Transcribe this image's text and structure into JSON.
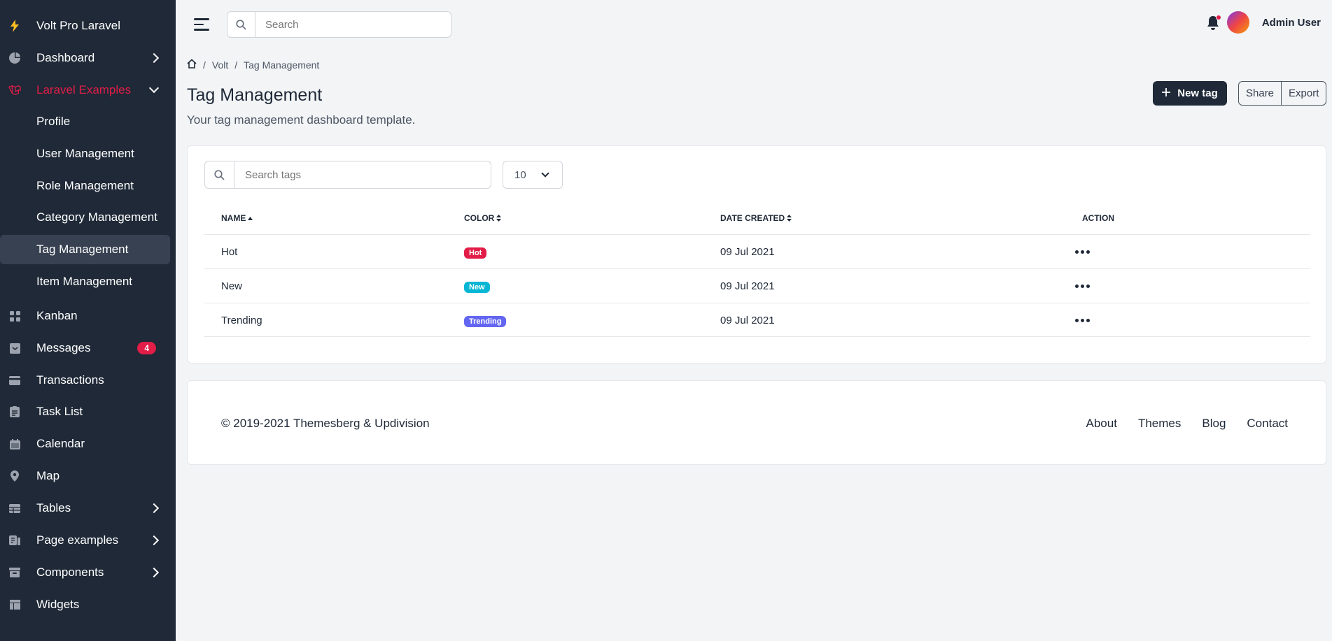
{
  "sidebar": {
    "brand": "Volt Pro Laravel",
    "items": [
      {
        "label": "Dashboard",
        "icon": "pie-chart-icon"
      },
      {
        "label": "Laravel Examples",
        "icon": "laravel-icon"
      },
      {
        "label": "Profile"
      },
      {
        "label": "User Management"
      },
      {
        "label": "Role Management"
      },
      {
        "label": "Category Management"
      },
      {
        "label": "Tag Management"
      },
      {
        "label": "Item Management"
      },
      {
        "label": "Kanban",
        "icon": "grid-icon"
      },
      {
        "label": "Messages",
        "icon": "inbox-icon",
        "badge": "4"
      },
      {
        "label": "Transactions",
        "icon": "credit-card-icon"
      },
      {
        "label": "Task List",
        "icon": "clipboard-icon"
      },
      {
        "label": "Calendar",
        "icon": "calendar-icon"
      },
      {
        "label": "Map",
        "icon": "location-icon"
      },
      {
        "label": "Tables",
        "icon": "table-icon"
      },
      {
        "label": "Page examples",
        "icon": "pages-icon"
      },
      {
        "label": "Components",
        "icon": "archive-icon"
      },
      {
        "label": "Widgets",
        "icon": "widgets-icon"
      }
    ]
  },
  "topbar": {
    "search_placeholder": "Search",
    "user_name": "Admin User"
  },
  "breadcrumb": [
    "Volt",
    "Tag Management"
  ],
  "page": {
    "title": "Tag Management",
    "subtitle": "Your tag management dashboard template.",
    "new_button": "New tag",
    "share_button": "Share",
    "export_button": "Export"
  },
  "table": {
    "search_placeholder": "Search tags",
    "per_page": "10",
    "headers": [
      "NAME",
      "COLOR",
      "DATE CREATED",
      "ACTION"
    ],
    "rows": [
      {
        "name": "Hot",
        "color_label": "Hot",
        "color": "#e11d48",
        "date": "09 Jul 2021"
      },
      {
        "name": "New",
        "color_label": "New",
        "color": "#06b6d4",
        "date": "09 Jul 2021"
      },
      {
        "name": "Trending",
        "color_label": "Trending",
        "color": "#6366f1",
        "date": "09 Jul 2021"
      }
    ]
  },
  "footer": {
    "copyright": "© 2019-2021 Themesberg & Updivision",
    "links": [
      "About",
      "Themes",
      "Blog",
      "Contact"
    ]
  },
  "colors": {
    "sidebar_bg": "#1f2937",
    "accent_red": "#e11d48",
    "page_bg": "#f2f4f6"
  }
}
